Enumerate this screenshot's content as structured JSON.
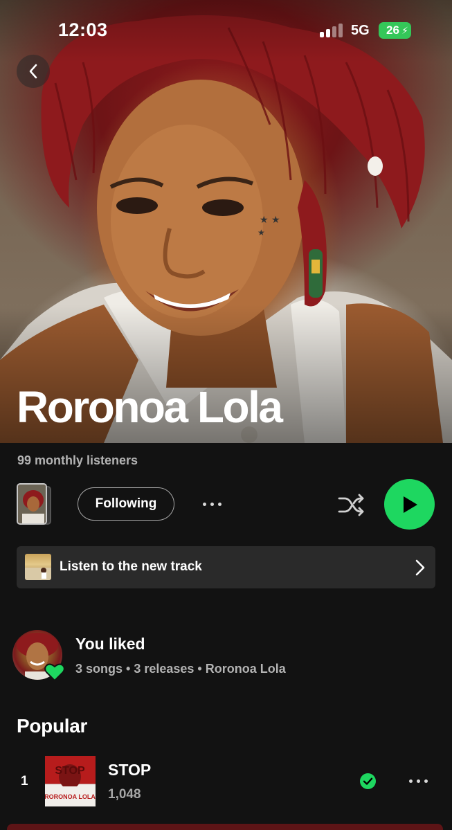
{
  "status_bar": {
    "time": "12:03",
    "network": "5G",
    "battery": "26"
  },
  "artist": {
    "name": "Roronoa Lola",
    "monthly_listeners": "99 monthly listeners"
  },
  "actions": {
    "following_label": "Following"
  },
  "promo": {
    "label": "Listen to the new track"
  },
  "liked": {
    "title": "You liked",
    "subtitle": "3 songs • 3 releases • Roronoa Lola"
  },
  "popular": {
    "title": "Popular",
    "tracks": [
      {
        "rank": "1",
        "title": "STOP",
        "plays": "1,048",
        "cover_text_top": "STOP",
        "cover_text_bottom": "RORONOA LOLA"
      }
    ]
  },
  "colors": {
    "accent": "#1ed760",
    "background": "#121212",
    "hair_red": "#8e1a1d"
  },
  "icons": {
    "back": "chevron-left-icon",
    "more": "more-horizontal-icon",
    "shuffle": "shuffle-icon",
    "play": "play-icon",
    "chevron": "chevron-right-icon",
    "liked_badge": "heart-icon",
    "saved": "check-circle-icon"
  }
}
